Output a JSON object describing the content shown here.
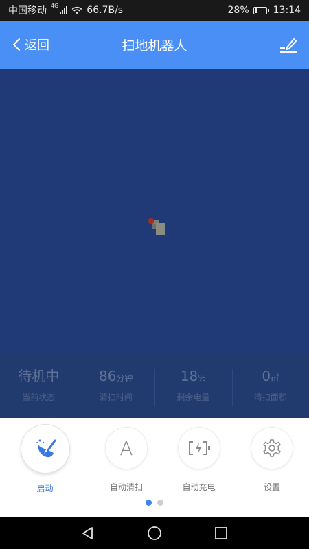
{
  "status_bar": {
    "carrier": "中国移动",
    "network": "4G",
    "speed": "66.7B/s",
    "battery_percent": "28%",
    "battery_level": 0.28,
    "time": "13:14"
  },
  "header": {
    "back_label": "返回",
    "title": "扫地机器人",
    "edit_icon": "edit-icon",
    "background": "#4a8ff5"
  },
  "map": {
    "background": "#1f3a77"
  },
  "stats": [
    {
      "value": "待机中",
      "unit": "",
      "label": "当前状态"
    },
    {
      "value": "86",
      "unit": "分钟",
      "label": "清扫时间"
    },
    {
      "value": "18",
      "unit": "%",
      "label": "剩余电量"
    },
    {
      "value": "0",
      "unit": "㎡",
      "label": "清扫面积"
    }
  ],
  "actions": [
    {
      "label": "启动",
      "icon": "broom-icon",
      "active": true
    },
    {
      "label": "自动清扫",
      "icon": "letter-a-icon",
      "glyph": "A"
    },
    {
      "label": "自动充电",
      "icon": "charging-icon"
    },
    {
      "label": "设置",
      "icon": "gear-icon"
    }
  ],
  "pagination": {
    "pages": 2,
    "current": 1
  },
  "colors": {
    "accent": "#4a8ff5",
    "active_label": "#3b78e0",
    "dot_active": "#3b86f0"
  }
}
